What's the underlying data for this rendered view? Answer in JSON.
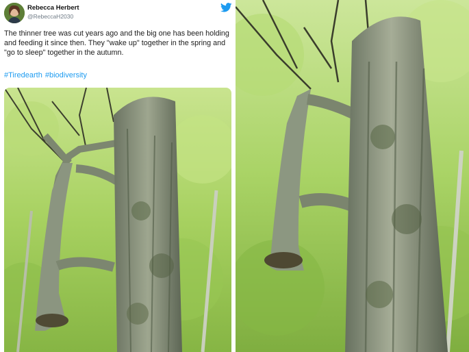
{
  "tweet": {
    "display_name": "Rebecca Herbert",
    "handle": "@RebeccaH2030",
    "text": "The thinner tree was cut years ago and the big one has been holding and feeding it since then. They \"wake up\" together in the spring and \"go to sleep\" together in the autumn.",
    "hashtags": [
      "#Tiredearth",
      "#biodiversity"
    ],
    "brand_icon": "twitter-bird-icon",
    "brand_color": "#1d9bf0"
  },
  "colors": {
    "foliage": "#a6cf5c",
    "bark": "#8f9a84",
    "hashtag": "#1d9bf0"
  }
}
